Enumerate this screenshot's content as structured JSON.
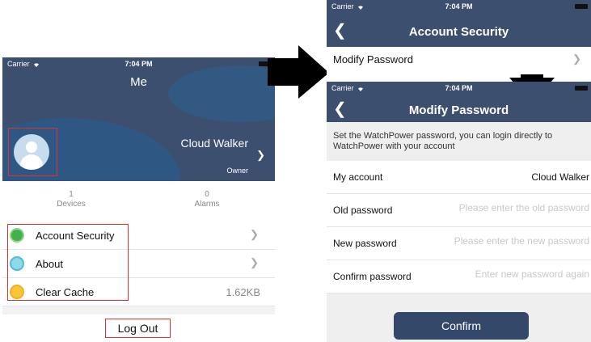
{
  "status_bar": {
    "carrier": "Carrier",
    "time": "7:04 PM"
  },
  "me_screen": {
    "title": "Me",
    "username": "Cloud Walker",
    "role": "Owner",
    "stats": [
      {
        "value": "1",
        "label": "Devices"
      },
      {
        "value": "0",
        "label": "Alarms"
      }
    ],
    "menu": [
      {
        "label": "Account Security",
        "icon": "shield-icon"
      },
      {
        "label": "About",
        "icon": "document-icon"
      },
      {
        "label": "Clear Cache",
        "icon": "broom-icon",
        "value": "1.62KB"
      }
    ],
    "logout_label": "Log Out"
  },
  "account_security_screen": {
    "title": "Account Security",
    "row_label": "Modify Password"
  },
  "modify_password_screen": {
    "title": "Modify Password",
    "note": "Set the WatchPower password, you can login directly to WatchPower with your account",
    "fields": {
      "account": {
        "label": "My account",
        "value": "Cloud Walker"
      },
      "old": {
        "label": "Old password",
        "placeholder": "Please enter the old password"
      },
      "new": {
        "label": "New password",
        "placeholder": "Please enter the new password"
      },
      "confirm": {
        "label": "Confirm password",
        "placeholder": "Enter new password again"
      }
    },
    "confirm_label": "Confirm"
  },
  "colors": {
    "nav": "#3c4f6e",
    "highlight": "#e03030",
    "button": "#34486a"
  }
}
